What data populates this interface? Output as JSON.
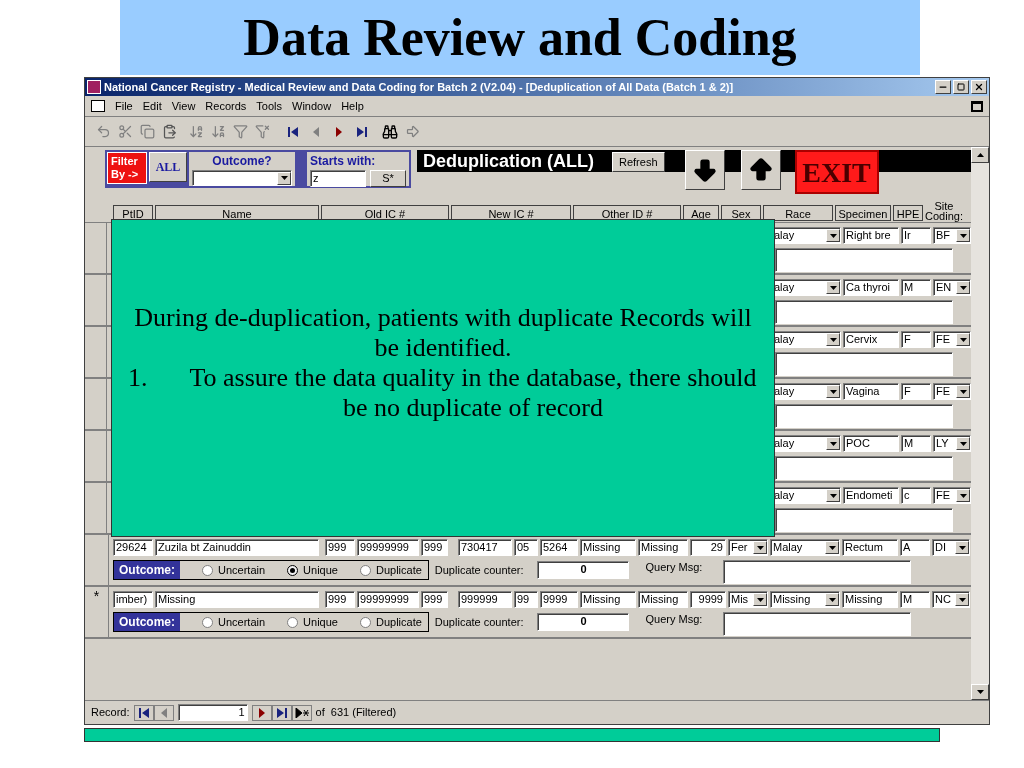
{
  "slide_title": "Data Review and Coding",
  "window": {
    "title": "National Cancer Registry - Medical Review and Data Coding for Batch 2 (V2.04) - [Deduplication of All Data (Batch 1 & 2)]"
  },
  "menu": [
    "File",
    "Edit",
    "View",
    "Records",
    "Tools",
    "Window",
    "Help"
  ],
  "form_header": {
    "filter_label": "Filter By ->",
    "all_button": "ALL",
    "outcome_label": "Outcome?",
    "starts_label": "Starts with:",
    "starts_value": "z",
    "starts_button": "S*",
    "heading": "Deduplication (ALL)",
    "refresh": "Refresh",
    "exit": "EXIT"
  },
  "columns": [
    "PtID",
    "Name",
    "Old IC #",
    "New IC #",
    "Other ID #",
    "Age",
    "Sex",
    "Race",
    "Specimen",
    "HPE",
    "Site Coding:"
  ],
  "covered_rows": [
    {
      "race": "alay",
      "specimen": "Right bre",
      "hpe": "Ir",
      "site": "BF"
    },
    {
      "race": "alay",
      "specimen": "Ca thyroi",
      "hpe": "M",
      "site": "EN"
    },
    {
      "race": "alay",
      "specimen": "Cervix",
      "hpe": "F",
      "site": "FE"
    },
    {
      "race": "alay",
      "specimen": "Vagina",
      "hpe": "F",
      "site": "FE"
    },
    {
      "race": "alay",
      "specimen": "POC",
      "hpe": "M",
      "site": "LY"
    },
    {
      "race": "alay",
      "specimen": "Endometi",
      "hpe": "c",
      "site": "FE"
    }
  ],
  "records": [
    {
      "ptid": "29624",
      "name": "Zuzila bt Zainuddin",
      "old_ic": [
        "999",
        "99999999",
        "999"
      ],
      "new_ic": [
        "730417",
        "05",
        "5264"
      ],
      "other_id": [
        "Missing",
        "Missing"
      ],
      "age": "29",
      "sex": "Fer",
      "race": "Malay",
      "specimen": "Rectum",
      "hpe": "A",
      "site": "DI",
      "outcome_label": "Outcome:",
      "options": [
        {
          "label": "Uncertain",
          "selected": false
        },
        {
          "label": "Unique",
          "selected": true
        },
        {
          "label": "Duplicate",
          "selected": false
        }
      ],
      "counter_label": "Duplicate counter:",
      "counter": "0",
      "query_label": "Query Msg:"
    },
    {
      "selector": "*",
      "ptid": "imber)",
      "name": "Missing",
      "old_ic": [
        "999",
        "99999999",
        "999"
      ],
      "new_ic": [
        "999999",
        "99",
        "9999"
      ],
      "other_id": [
        "Missing",
        "Missing"
      ],
      "age": "9999",
      "sex": "Mis",
      "race": "Missing",
      "specimen": "Missing",
      "hpe": "M",
      "site": "NC",
      "outcome_label": "Outcome:",
      "options": [
        {
          "label": "Uncertain",
          "selected": false
        },
        {
          "label": "Unique",
          "selected": false
        },
        {
          "label": "Duplicate",
          "selected": false
        }
      ],
      "counter_label": "Duplicate counter:",
      "counter": "0",
      "query_label": "Query Msg:"
    }
  ],
  "navigator": {
    "label": "Record:",
    "current": "1",
    "total": "of  631 (Filtered)"
  },
  "callout": {
    "paragraph": "During de-duplication, patients with duplicate Records will be identified.",
    "items": [
      {
        "number": "1.",
        "text": "To assure the data quality in the database, there should be no duplicate of record"
      }
    ]
  }
}
